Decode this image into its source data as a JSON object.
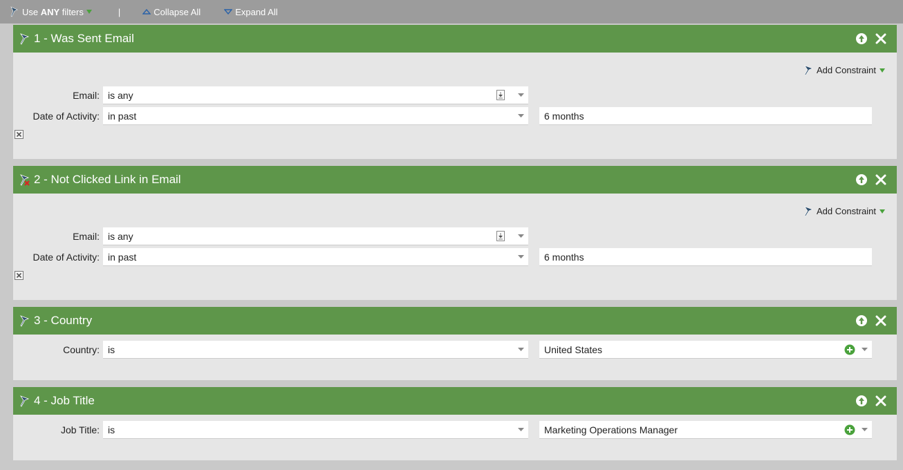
{
  "toolbar": {
    "use_prefix": "Use ",
    "use_any": "ANY",
    "use_suffix": " filters",
    "separator": "|",
    "collapse_all": "Collapse All",
    "expand_all": "Expand All"
  },
  "filters": [
    {
      "title": "1 - Was Sent Email",
      "add_constraint": "Add Constraint",
      "email_label": "Email:",
      "email_value": "is any",
      "date_label": "Date of Activity:",
      "date_op": "in past",
      "date_value": "6 months"
    },
    {
      "title": "2 - Not Clicked Link in Email",
      "add_constraint": "Add Constraint",
      "email_label": "Email:",
      "email_value": "is any",
      "date_label": "Date of Activity:",
      "date_op": "in past",
      "date_value": "6 months"
    },
    {
      "title": "3 - Country",
      "field_label": "Country:",
      "op": "is",
      "value": "United States"
    },
    {
      "title": "4 - Job Title",
      "field_label": "Job Title:",
      "op": "is",
      "value": "Marketing Operations Manager"
    }
  ],
  "colors": {
    "header_green": "#5e964a",
    "panel_bg": "#e6e6e6",
    "toolbar_bg": "#9c9c9c",
    "accent_green": "#4aa23c"
  },
  "icons": {
    "filter": "filter-wand-icon",
    "negated_filter": "filter-wand-negated-icon",
    "move_up": "arrow-up-circle-icon",
    "close": "close-x-icon",
    "remove_constraint": "remove-constraint-icon",
    "picker": "list-picker-icon",
    "add_value": "plus-circle-icon"
  }
}
